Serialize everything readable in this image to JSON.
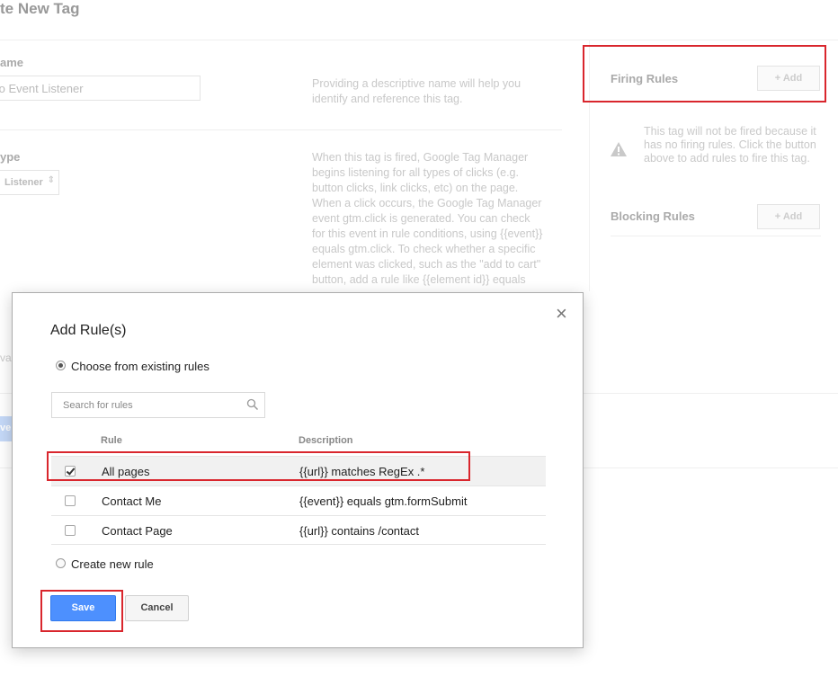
{
  "page": {
    "title": "te New Tag",
    "name_section": {
      "label": "ame",
      "value": "to Event Listener",
      "help": "Providing a descriptive name will help you identify and reference this tag."
    },
    "type_section": {
      "label": "ype",
      "value": "Listener",
      "help_lines": [
        "When this tag is fired, Google Tag Manager",
        "begins listening for all types of clicks (e.g.",
        "button clicks, link clicks, etc) on the page.",
        "When a click occurs, the Google Tag Manager",
        "event gtm.click is generated. You can check",
        "for this event in rule conditions, using {{event}}",
        "equals gtm.click. To check whether a specific",
        "element was clicked, such as the \"add to cart\"",
        "button, add a rule like {{element id}} equals"
      ]
    },
    "partial_labels": {
      "left_va": "va",
      "left_ve": "ve"
    }
  },
  "sidebar": {
    "firing_rules_heading": "Firing Rules",
    "firing_add_label": "+ Add",
    "warning_text": "This tag will not be fired because it has no firing rules. Click the button above to add rules to fire this tag.",
    "blocking_rules_heading": "Blocking Rules",
    "blocking_add_label": "+ Add"
  },
  "modal": {
    "title": "Add Rule(s)",
    "close_symbol": "×",
    "choose_existing_label": "Choose from existing rules",
    "search_placeholder": "Search for rules",
    "columns": {
      "rule": "Rule",
      "description": "Description"
    },
    "rows": [
      {
        "name": "All pages",
        "description": "{{url}} matches RegEx .*",
        "checked": true
      },
      {
        "name": "Contact Me",
        "description": "{{event}} equals gtm.formSubmit",
        "checked": false
      },
      {
        "name": "Contact Page",
        "description": "{{url}} contains /contact",
        "checked": false
      }
    ],
    "create_new_label": "Create new rule",
    "save_label": "Save",
    "cancel_label": "Cancel"
  },
  "colors": {
    "highlight_red": "#d9262d",
    "save_blue": "#4d90fe"
  }
}
